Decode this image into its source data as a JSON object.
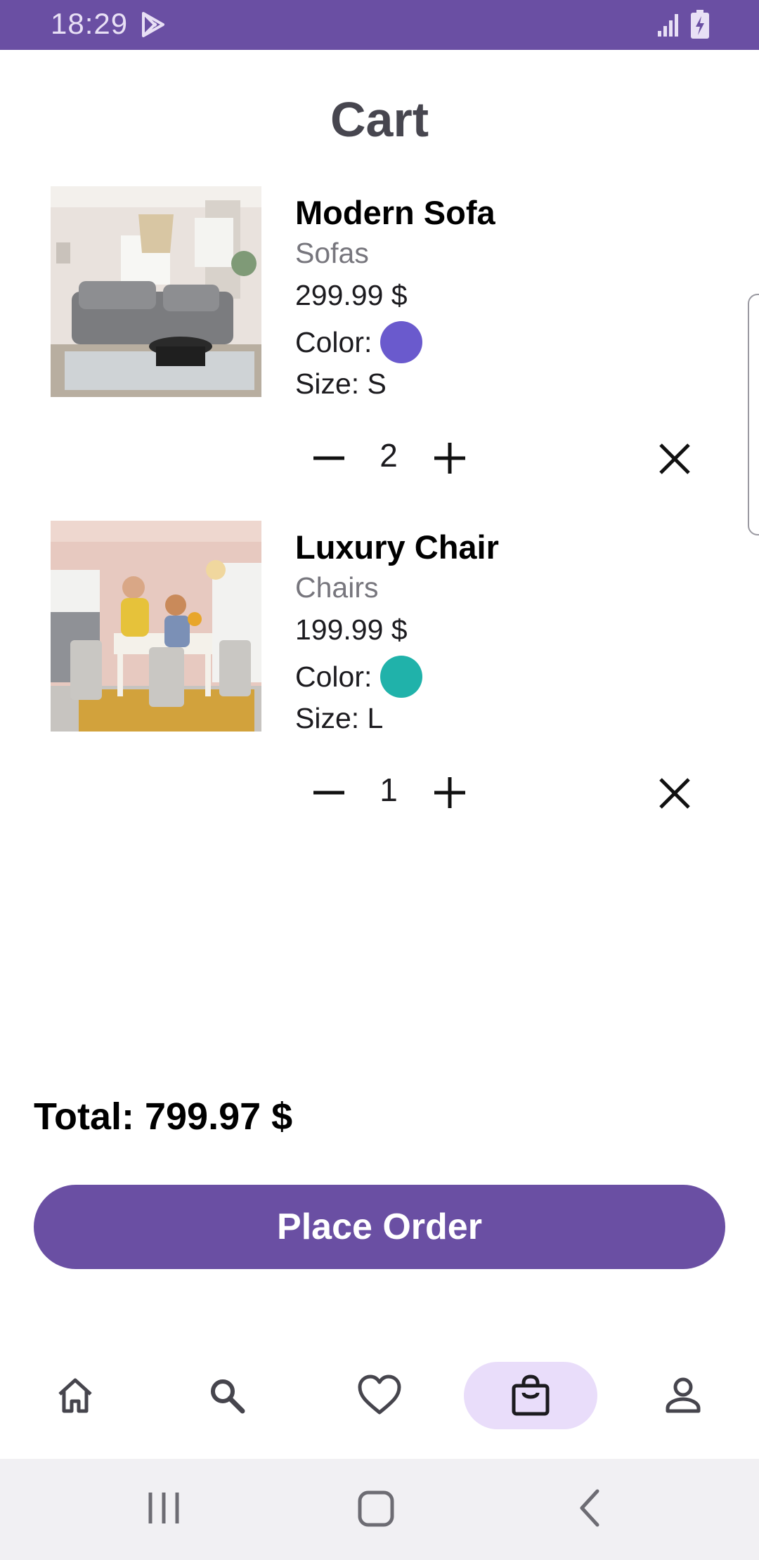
{
  "status_bar": {
    "time": "18:29"
  },
  "page": {
    "title": "Cart"
  },
  "cart": {
    "items": [
      {
        "name": "Modern Sofa",
        "category": "Sofas",
        "price": "299.99 $",
        "color_label": "Color:",
        "color_hex": "#6a5acd",
        "size": "Size: S",
        "quantity": "2"
      },
      {
        "name": "Luxury Chair",
        "category": "Chairs",
        "price": "199.99 $",
        "color_label": "Color:",
        "color_hex": "#20b2aa",
        "size": "Size: L",
        "quantity": "1"
      }
    ],
    "total": "Total: 799.97 $",
    "place_order_label": "Place Order"
  },
  "bottom_nav": {
    "items": [
      {
        "icon": "home-icon"
      },
      {
        "icon": "search-icon"
      },
      {
        "icon": "heart-icon"
      },
      {
        "icon": "shopping-bag-icon",
        "active": true
      },
      {
        "icon": "profile-icon"
      }
    ]
  },
  "colors": {
    "primary": "#6a4fa3",
    "nav_active_bg": "#e9ddfa",
    "title": "#47464f"
  }
}
